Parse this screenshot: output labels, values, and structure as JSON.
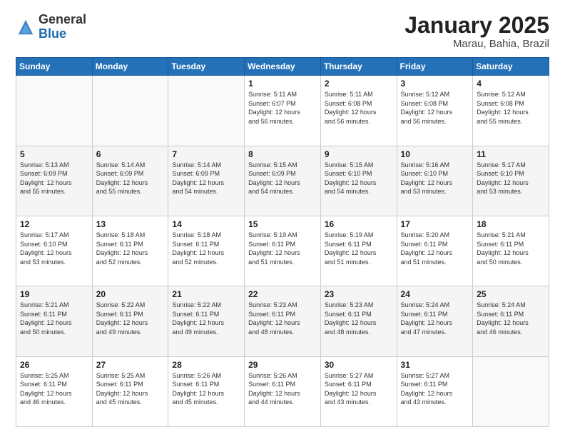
{
  "logo": {
    "general": "General",
    "blue": "Blue"
  },
  "header": {
    "title": "January 2025",
    "subtitle": "Marau, Bahia, Brazil"
  },
  "weekdays": [
    "Sunday",
    "Monday",
    "Tuesday",
    "Wednesday",
    "Thursday",
    "Friday",
    "Saturday"
  ],
  "weeks": [
    {
      "bg": "odd-week",
      "days": [
        {
          "num": "",
          "info": ""
        },
        {
          "num": "",
          "info": ""
        },
        {
          "num": "",
          "info": ""
        },
        {
          "num": "1",
          "info": "Sunrise: 5:11 AM\nSunset: 6:07 PM\nDaylight: 12 hours\nand 56 minutes."
        },
        {
          "num": "2",
          "info": "Sunrise: 5:11 AM\nSunset: 6:08 PM\nDaylight: 12 hours\nand 56 minutes."
        },
        {
          "num": "3",
          "info": "Sunrise: 5:12 AM\nSunset: 6:08 PM\nDaylight: 12 hours\nand 56 minutes."
        },
        {
          "num": "4",
          "info": "Sunrise: 5:12 AM\nSunset: 6:08 PM\nDaylight: 12 hours\nand 55 minutes."
        }
      ]
    },
    {
      "bg": "even-week",
      "days": [
        {
          "num": "5",
          "info": "Sunrise: 5:13 AM\nSunset: 6:09 PM\nDaylight: 12 hours\nand 55 minutes."
        },
        {
          "num": "6",
          "info": "Sunrise: 5:14 AM\nSunset: 6:09 PM\nDaylight: 12 hours\nand 55 minutes."
        },
        {
          "num": "7",
          "info": "Sunrise: 5:14 AM\nSunset: 6:09 PM\nDaylight: 12 hours\nand 54 minutes."
        },
        {
          "num": "8",
          "info": "Sunrise: 5:15 AM\nSunset: 6:09 PM\nDaylight: 12 hours\nand 54 minutes."
        },
        {
          "num": "9",
          "info": "Sunrise: 5:15 AM\nSunset: 6:10 PM\nDaylight: 12 hours\nand 54 minutes."
        },
        {
          "num": "10",
          "info": "Sunrise: 5:16 AM\nSunset: 6:10 PM\nDaylight: 12 hours\nand 53 minutes."
        },
        {
          "num": "11",
          "info": "Sunrise: 5:17 AM\nSunset: 6:10 PM\nDaylight: 12 hours\nand 53 minutes."
        }
      ]
    },
    {
      "bg": "odd-week",
      "days": [
        {
          "num": "12",
          "info": "Sunrise: 5:17 AM\nSunset: 6:10 PM\nDaylight: 12 hours\nand 53 minutes."
        },
        {
          "num": "13",
          "info": "Sunrise: 5:18 AM\nSunset: 6:11 PM\nDaylight: 12 hours\nand 52 minutes."
        },
        {
          "num": "14",
          "info": "Sunrise: 5:18 AM\nSunset: 6:11 PM\nDaylight: 12 hours\nand 52 minutes."
        },
        {
          "num": "15",
          "info": "Sunrise: 5:19 AM\nSunset: 6:11 PM\nDaylight: 12 hours\nand 51 minutes."
        },
        {
          "num": "16",
          "info": "Sunrise: 5:19 AM\nSunset: 6:11 PM\nDaylight: 12 hours\nand 51 minutes."
        },
        {
          "num": "17",
          "info": "Sunrise: 5:20 AM\nSunset: 6:11 PM\nDaylight: 12 hours\nand 51 minutes."
        },
        {
          "num": "18",
          "info": "Sunrise: 5:21 AM\nSunset: 6:11 PM\nDaylight: 12 hours\nand 50 minutes."
        }
      ]
    },
    {
      "bg": "even-week",
      "days": [
        {
          "num": "19",
          "info": "Sunrise: 5:21 AM\nSunset: 6:11 PM\nDaylight: 12 hours\nand 50 minutes."
        },
        {
          "num": "20",
          "info": "Sunrise: 5:22 AM\nSunset: 6:11 PM\nDaylight: 12 hours\nand 49 minutes."
        },
        {
          "num": "21",
          "info": "Sunrise: 5:22 AM\nSunset: 6:11 PM\nDaylight: 12 hours\nand 49 minutes."
        },
        {
          "num": "22",
          "info": "Sunrise: 5:23 AM\nSunset: 6:11 PM\nDaylight: 12 hours\nand 48 minutes."
        },
        {
          "num": "23",
          "info": "Sunrise: 5:23 AM\nSunset: 6:11 PM\nDaylight: 12 hours\nand 48 minutes."
        },
        {
          "num": "24",
          "info": "Sunrise: 5:24 AM\nSunset: 6:11 PM\nDaylight: 12 hours\nand 47 minutes."
        },
        {
          "num": "25",
          "info": "Sunrise: 5:24 AM\nSunset: 6:11 PM\nDaylight: 12 hours\nand 46 minutes."
        }
      ]
    },
    {
      "bg": "odd-week",
      "days": [
        {
          "num": "26",
          "info": "Sunrise: 5:25 AM\nSunset: 6:11 PM\nDaylight: 12 hours\nand 46 minutes."
        },
        {
          "num": "27",
          "info": "Sunrise: 5:25 AM\nSunset: 6:11 PM\nDaylight: 12 hours\nand 45 minutes."
        },
        {
          "num": "28",
          "info": "Sunrise: 5:26 AM\nSunset: 6:11 PM\nDaylight: 12 hours\nand 45 minutes."
        },
        {
          "num": "29",
          "info": "Sunrise: 5:26 AM\nSunset: 6:11 PM\nDaylight: 12 hours\nand 44 minutes."
        },
        {
          "num": "30",
          "info": "Sunrise: 5:27 AM\nSunset: 6:11 PM\nDaylight: 12 hours\nand 43 minutes."
        },
        {
          "num": "31",
          "info": "Sunrise: 5:27 AM\nSunset: 6:11 PM\nDaylight: 12 hours\nand 43 minutes."
        },
        {
          "num": "",
          "info": ""
        }
      ]
    }
  ]
}
